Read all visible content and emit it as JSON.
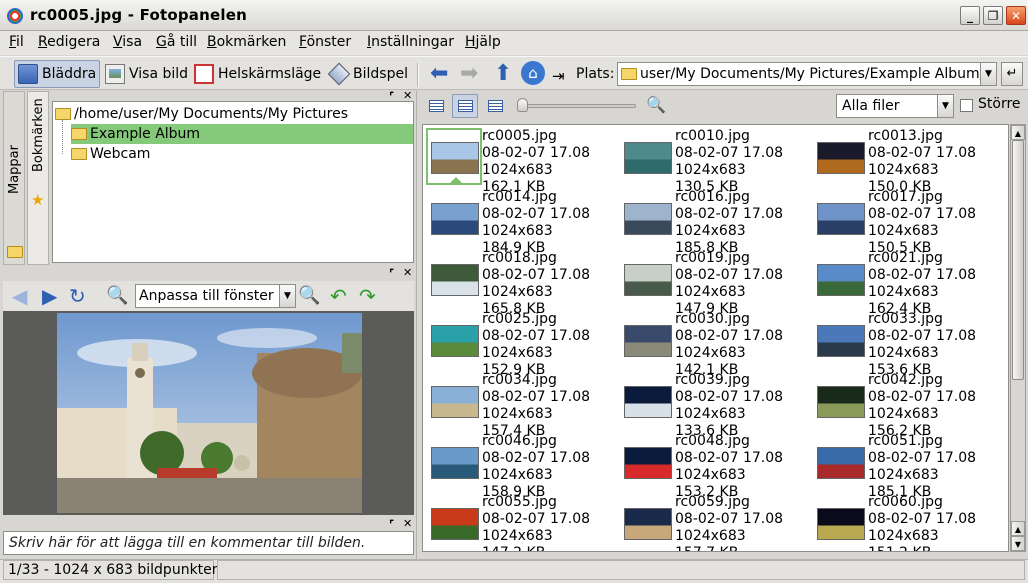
{
  "window": {
    "title": "rc0005.jpg - Fotopanelen"
  },
  "menu": [
    {
      "u": "F",
      "rest": "il"
    },
    {
      "u": "R",
      "rest": "edigera"
    },
    {
      "u": "V",
      "rest": "isa"
    },
    {
      "u": "G",
      "rest": "å till"
    },
    {
      "u": "B",
      "rest": "okmärken"
    },
    {
      "u": "F",
      "rest": "önster"
    },
    {
      "u": "I",
      "rest": "nställningar"
    },
    {
      "u": "H",
      "rest": "jälp"
    }
  ],
  "toolbar": {
    "browse_label": "Bläddra",
    "view_label": "Visa bild",
    "fullscreen_label": "Helskärmsläge",
    "slideshow_label": "Bildspel",
    "location_label": "Plats:",
    "location_value": "user/My Documents/My Pictures/Example Album/"
  },
  "sidebar_tabs": {
    "folders": "Mappar",
    "bookmarks": "Bokmärken"
  },
  "tree": {
    "root": "/home/user/My Documents/My Pictures",
    "items": [
      "Example Album",
      "Webcam"
    ]
  },
  "viewer": {
    "zoom_mode": "Anpassa till fönster"
  },
  "comment_placeholder": "Skriv här för att lägga till en kommentar till bilden.",
  "filter": {
    "selected": "Alla filer",
    "larger_label": "Större"
  },
  "thumbnails": [
    {
      "name": "rc0005.jpg",
      "date": "08-02-07 17.08",
      "dims": "1024x683",
      "size": "162.1 KB",
      "c1": "#a9c6e6",
      "c2": "#8a7350"
    },
    {
      "name": "rc0010.jpg",
      "date": "08-02-07 17.08",
      "dims": "1024x683",
      "size": "130.5 KB",
      "c1": "#4f8a8a",
      "c2": "#2f6b6b"
    },
    {
      "name": "rc0013.jpg",
      "date": "08-02-07 17.08",
      "dims": "1024x683",
      "size": "150.0 KB",
      "c1": "#1a1a2a",
      "c2": "#b06a20"
    },
    {
      "name": "rc0014.jpg",
      "date": "08-02-07 17.08",
      "dims": "1024x683",
      "size": "184.9 KB",
      "c1": "#7aa0cf",
      "c2": "#2a4a7a"
    },
    {
      "name": "rc0016.jpg",
      "date": "08-02-07 17.08",
      "dims": "1024x683",
      "size": "185.8 KB",
      "c1": "#9db4cc",
      "c2": "#3a4a5a"
    },
    {
      "name": "rc0017.jpg",
      "date": "08-02-07 17.08",
      "dims": "1024x683",
      "size": "150.5 KB",
      "c1": "#6f93c8",
      "c2": "#2a3f66"
    },
    {
      "name": "rc0018.jpg",
      "date": "08-02-07 17.08",
      "dims": "1024x683",
      "size": "165.8 KB",
      "c1": "#3f5a3a",
      "c2": "#d8e2e8"
    },
    {
      "name": "rc0019.jpg",
      "date": "08-02-07 17.08",
      "dims": "1024x683",
      "size": "147.9 KB",
      "c1": "#c8cfc8",
      "c2": "#4a5a4a"
    },
    {
      "name": "rc0021.jpg",
      "date": "08-02-07 17.08",
      "dims": "1024x683",
      "size": "162.4 KB",
      "c1": "#5a8ac8",
      "c2": "#3a6a3a"
    },
    {
      "name": "rc0025.jpg",
      "date": "08-02-07 17.08",
      "dims": "1024x683",
      "size": "152.9 KB",
      "c1": "#2aa0a8",
      "c2": "#5a8a3a"
    },
    {
      "name": "rc0030.jpg",
      "date": "08-02-07 17.08",
      "dims": "1024x683",
      "size": "142.1 KB",
      "c1": "#3a4a6a",
      "c2": "#8a8a7a"
    },
    {
      "name": "rc0033.jpg",
      "date": "08-02-07 17.08",
      "dims": "1024x683",
      "size": "153.6 KB",
      "c1": "#4a78b8",
      "c2": "#2a3a4a"
    },
    {
      "name": "rc0034.jpg",
      "date": "08-02-07 17.08",
      "dims": "1024x683",
      "size": "157.4 KB",
      "c1": "#8ab0d8",
      "c2": "#c8b890"
    },
    {
      "name": "rc0039.jpg",
      "date": "08-02-07 17.08",
      "dims": "1024x683",
      "size": "133.6 KB",
      "c1": "#0a1a3a",
      "c2": "#d8e0e8"
    },
    {
      "name": "rc0042.jpg",
      "date": "08-02-07 17.08",
      "dims": "1024x683",
      "size": "156.2 KB",
      "c1": "#1a2a1a",
      "c2": "#8a9a5a"
    },
    {
      "name": "rc0046.jpg",
      "date": "08-02-07 17.08",
      "dims": "1024x683",
      "size": "158.9 KB",
      "c1": "#6a9ac8",
      "c2": "#2a5a7a"
    },
    {
      "name": "rc0048.jpg",
      "date": "08-02-07 17.08",
      "dims": "1024x683",
      "size": "153.2 KB",
      "c1": "#0a1a3a",
      "c2": "#d82a2a"
    },
    {
      "name": "rc0051.jpg",
      "date": "08-02-07 17.08",
      "dims": "1024x683",
      "size": "185.1 KB",
      "c1": "#3a6aa8",
      "c2": "#a82a2a"
    },
    {
      "name": "rc0055.jpg",
      "date": "08-02-07 17.08",
      "dims": "1024x683",
      "size": "147.2 KB",
      "c1": "#c83a1a",
      "c2": "#3a6a2a"
    },
    {
      "name": "rc0059.jpg",
      "date": "08-02-07 17.08",
      "dims": "1024x683",
      "size": "157.7 KB",
      "c1": "#1a2a4a",
      "c2": "#c8a87a"
    },
    {
      "name": "rc0060.jpg",
      "date": "08-02-07 17.08",
      "dims": "1024x683",
      "size": "151.2 KB",
      "c1": "#0a0a1a",
      "c2": "#b8a850"
    }
  ],
  "status": {
    "info": "1/33 - 1024 x 683 bildpunkter",
    "extra": ""
  }
}
